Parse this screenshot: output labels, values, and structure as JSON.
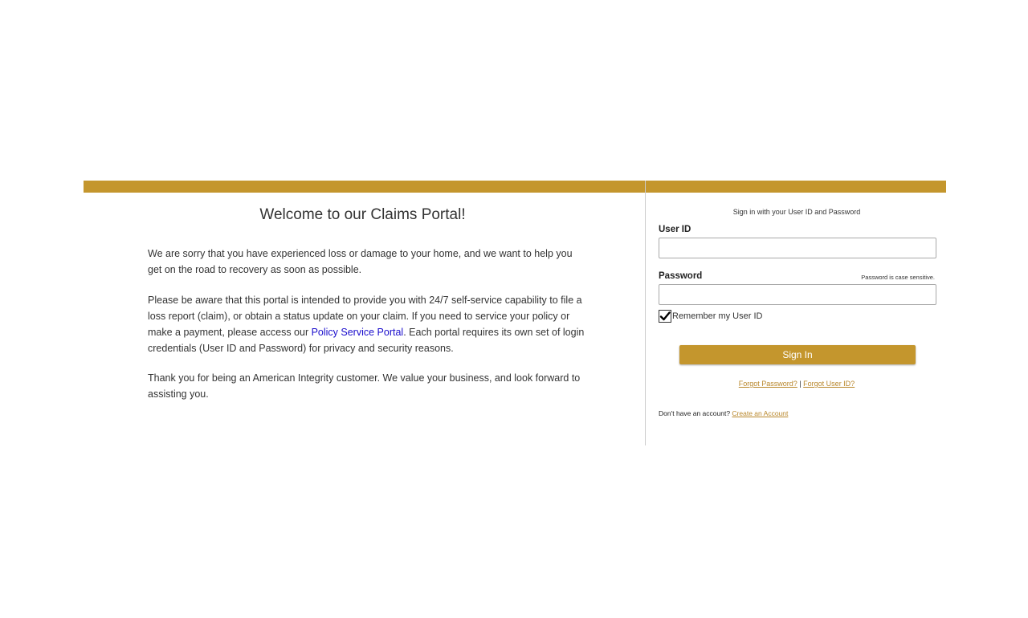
{
  "welcome": {
    "title": "Welcome to our Claims Portal!",
    "paragraph1": "We are sorry that you have experienced loss or damage to your home, and we want to help you get on the road to recovery as soon as possible.",
    "paragraph2_before_link": "Please be aware that this portal is intended to provide you with 24/7 self-service capability to file a loss report (claim), or obtain a status update on your claim. If you need to service your policy or make a payment, please access our ",
    "paragraph2_link": "Policy Service Portal",
    "paragraph2_after_link": ". Each portal requires its own set of login credentials (User ID and Password) for privacy and security reasons.",
    "paragraph3": "Thank you for being an American Integrity customer. We value your business, and look forward to assisting you."
  },
  "login": {
    "heading": "Sign in with your User ID and Password",
    "userid_label": "User ID",
    "userid_value": "",
    "password_label": "Password",
    "password_value": "",
    "case_note": "Password is case sensitive.",
    "remember_label": "Remember my User ID",
    "remember_checked": true,
    "signin_label": "Sign In",
    "forgot_password": "Forgot Password?",
    "separator": " | ",
    "forgot_userid": "Forgot User ID?",
    "no_account_text": "Don't have an account? ",
    "create_account": "Create an Account"
  },
  "colors": {
    "accent_gold": "#c4962d",
    "link_blue": "#1a0dcc"
  }
}
